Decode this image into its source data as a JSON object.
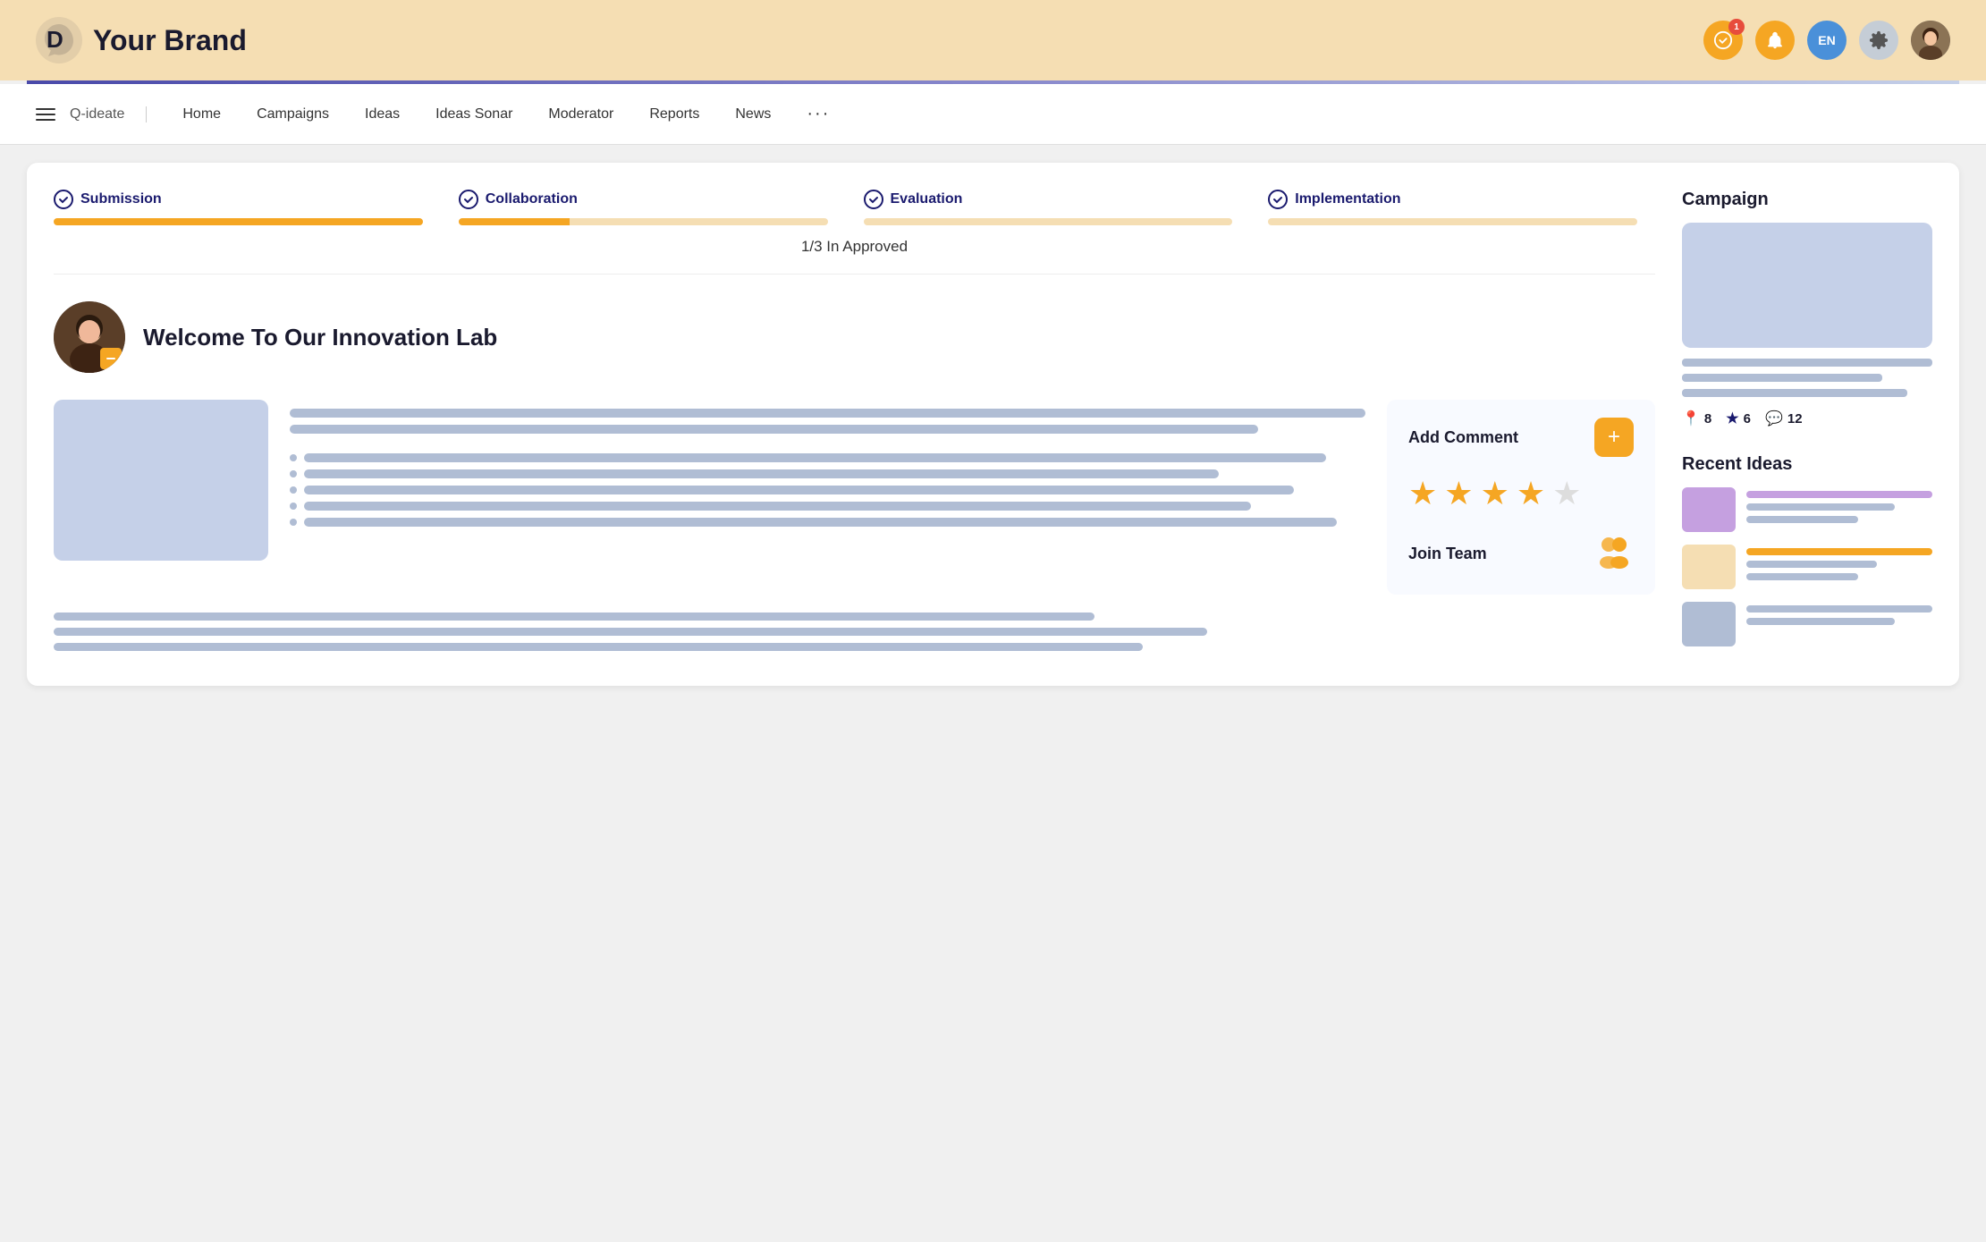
{
  "header": {
    "brand_logo_alt": "brand-logo",
    "brand_name": "Your Brand",
    "notification_count": "1",
    "lang_label": "EN"
  },
  "navbar": {
    "menu_label": "Q-ideate",
    "items": [
      {
        "label": "Home",
        "id": "home"
      },
      {
        "label": "Campaigns",
        "id": "campaigns"
      },
      {
        "label": "Ideas",
        "id": "ideas"
      },
      {
        "label": "Ideas Sonar",
        "id": "ideas-sonar"
      },
      {
        "label": "Moderator",
        "id": "moderator"
      },
      {
        "label": "Reports",
        "id": "reports"
      },
      {
        "label": "News",
        "id": "news"
      }
    ],
    "more_label": "···"
  },
  "progress": {
    "steps": [
      {
        "label": "Submission",
        "bar_type": "full"
      },
      {
        "label": "Collaboration",
        "bar_type": "partial"
      },
      {
        "label": "Evaluation",
        "bar_type": "light"
      },
      {
        "label": "Implementation",
        "bar_type": "light"
      }
    ],
    "approved_text": "1/3 In Approved"
  },
  "idea": {
    "title": "Welcome To Our Innovation Lab",
    "add_comment_label": "Add Comment",
    "plus_label": "+",
    "stars": [
      {
        "filled": true
      },
      {
        "filled": true
      },
      {
        "filled": true
      },
      {
        "filled": true
      },
      {
        "filled": false
      }
    ],
    "join_team_label": "Join Team"
  },
  "sidebar": {
    "campaign_title": "Campaign",
    "stats": [
      {
        "icon": "pin",
        "value": "8"
      },
      {
        "icon": "star",
        "value": "6"
      },
      {
        "icon": "comment",
        "value": "12"
      }
    ],
    "recent_ideas_title": "Recent Ideas",
    "recent_ideas": [
      {
        "color": "purple"
      },
      {
        "color": "orange"
      },
      {
        "color": "blue"
      }
    ]
  }
}
